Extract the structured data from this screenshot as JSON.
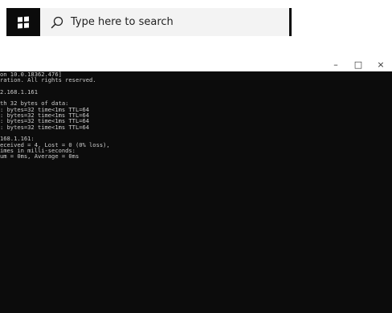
{
  "taskbar": {
    "start_icon": "windows-logo-icon",
    "search_icon": "search-icon",
    "search_placeholder": "Type here to search"
  },
  "window": {
    "controls": {
      "minimize": "–",
      "maximize": "□",
      "close": "×"
    }
  },
  "console": {
    "lines": [
      "on 10.0.18362.476]",
      "ration. All rights reserved.",
      "",
      "2.168.1.161",
      "",
      "th 32 bytes of data:",
      ": bytes=32 time<1ms TTL=64",
      ": bytes=32 time<1ms TTL=64",
      ": bytes=32 time<1ms TTL=64",
      ": bytes=32 time<1ms TTL=64",
      "",
      "168.1.161:",
      "eceived = 4, Lost = 0 (0% loss),",
      "imes in milli-seconds:",
      "um = 0ms, Average = 0ms"
    ]
  },
  "colors": {
    "console_background": "#0c0c0c",
    "console_text": "#cccccc",
    "taskbar_background": "#f3f3f3",
    "start_button": "#0b0b0b"
  }
}
